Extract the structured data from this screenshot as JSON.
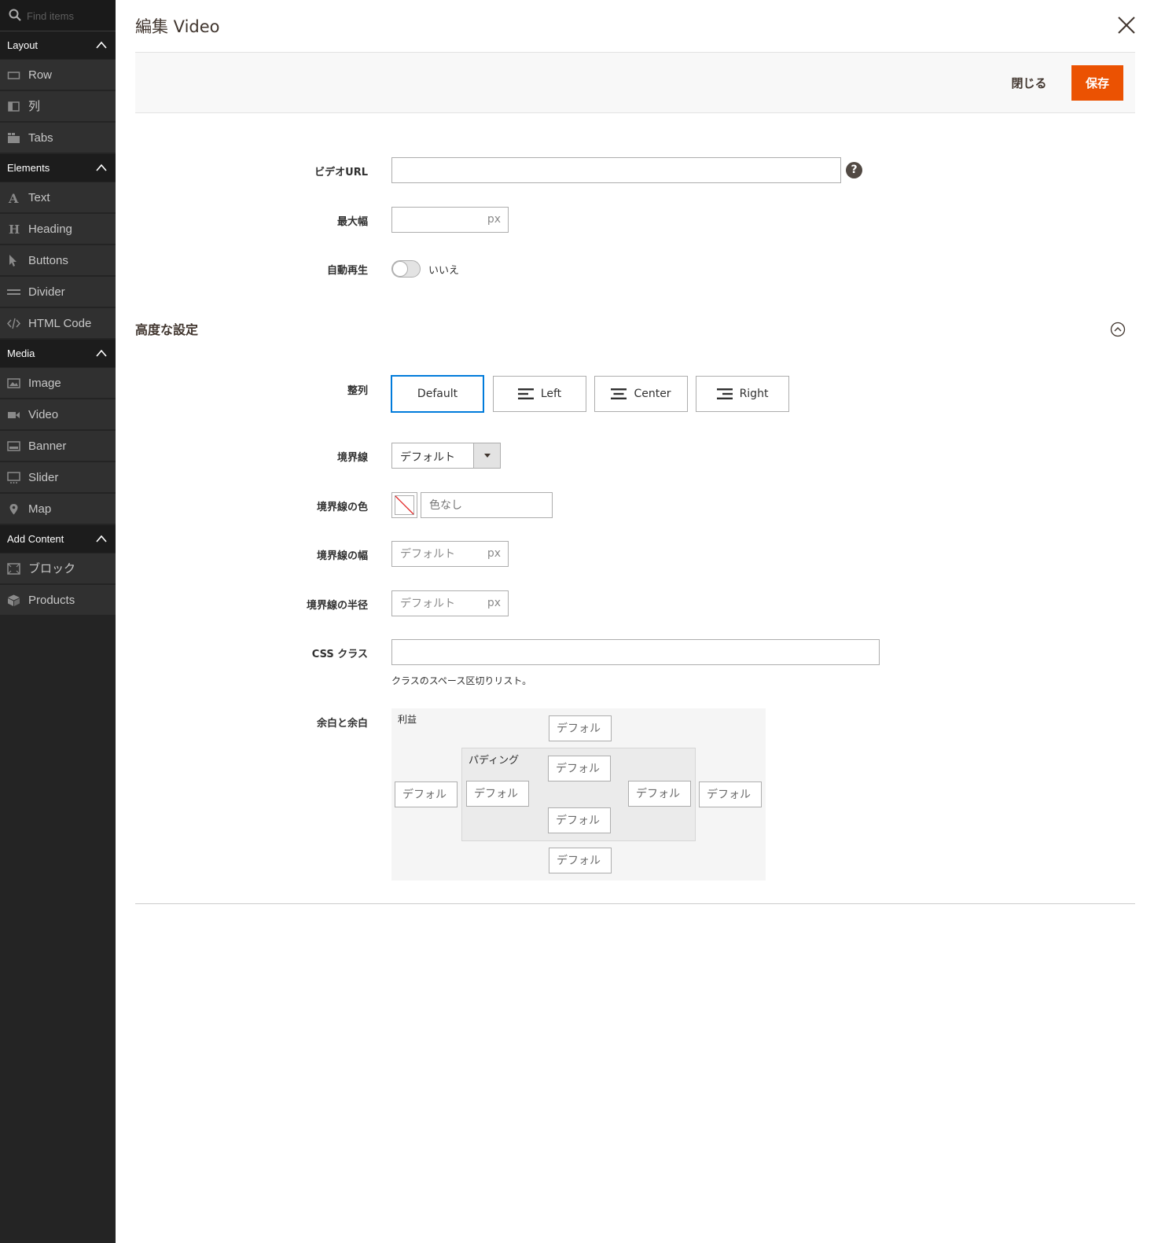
{
  "sidebar": {
    "search_placeholder": "Find items",
    "groups": [
      {
        "label": "Layout",
        "items": [
          {
            "label": "Row",
            "icon": "row-icon"
          },
          {
            "label": "列",
            "icon": "column-icon"
          },
          {
            "label": "Tabs",
            "icon": "tabs-icon"
          }
        ]
      },
      {
        "label": "Elements",
        "items": [
          {
            "label": "Text",
            "icon": "text-icon"
          },
          {
            "label": "Heading",
            "icon": "heading-icon"
          },
          {
            "label": "Buttons",
            "icon": "pointer-icon"
          },
          {
            "label": "Divider",
            "icon": "divider-icon"
          },
          {
            "label": "HTML Code",
            "icon": "code-icon"
          }
        ]
      },
      {
        "label": "Media",
        "items": [
          {
            "label": "Image",
            "icon": "image-icon"
          },
          {
            "label": "Video",
            "icon": "video-icon"
          },
          {
            "label": "Banner",
            "icon": "banner-icon"
          },
          {
            "label": "Slider",
            "icon": "slider-icon"
          },
          {
            "label": "Map",
            "icon": "map-pin-icon"
          }
        ]
      },
      {
        "label": "Add Content",
        "items": [
          {
            "label": "ブロック",
            "icon": "block-icon"
          },
          {
            "label": "Products",
            "icon": "products-icon"
          }
        ]
      }
    ]
  },
  "header": {
    "title": "編集 Video",
    "close_label": "閉じる",
    "save_label": "保存"
  },
  "form": {
    "video_url": {
      "label": "ビデオURL",
      "value": ""
    },
    "max_width": {
      "label": "最大幅",
      "value": "",
      "unit": "px"
    },
    "autoplay": {
      "label": "自動再生",
      "state": "いいえ"
    }
  },
  "advanced": {
    "title": "高度な設定",
    "alignment": {
      "label": "整列",
      "options": [
        "Default",
        "Left",
        "Center",
        "Right"
      ],
      "selected": "Default"
    },
    "border": {
      "label": "境界線",
      "value": "デフォルト"
    },
    "border_color": {
      "label": "境界線の色",
      "placeholder": "色なし"
    },
    "border_width": {
      "label": "境界線の幅",
      "placeholder": "デフォルト",
      "unit": "px"
    },
    "border_radius": {
      "label": "境界線の半径",
      "placeholder": "デフォルト",
      "unit": "px"
    },
    "css_classes": {
      "label": "CSS クラス",
      "value": "",
      "hint": "クラスのスペース区切りリスト。"
    },
    "margins_padding": {
      "label": "余白と余白",
      "margin_label": "利益",
      "padding_label": "パディング",
      "placeholder": "デフォルト"
    }
  },
  "colors": {
    "accent": "#eb5202",
    "sidebar_bg": "#303030",
    "focus": "#007bdb"
  }
}
